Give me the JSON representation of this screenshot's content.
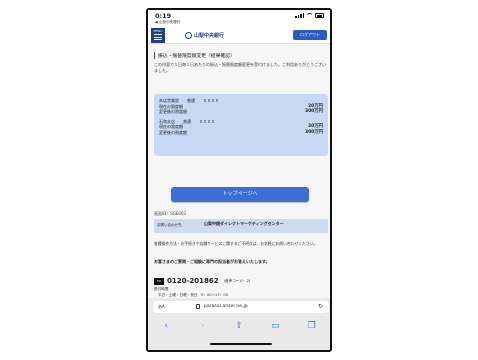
{
  "status_bar": {
    "time": "0:19",
    "back_label": "◀ 山梨中央銀行"
  },
  "header": {
    "menu_label": "MENU",
    "bank_name": "山梨中央銀行",
    "logout_label": "ログアウト"
  },
  "page": {
    "title": "振込・振替限度額変更（結果確認）",
    "intro": "この内容で１日毎１日あたりの振込・振替限度額変更を受付けました。ご利用ありがとうございました。"
  },
  "accounts": [
    {
      "branch": "本店営業部",
      "type": "普通",
      "number": "ＸＸＸＸ",
      "current_label": "現在の限度額",
      "current_amount": "20万円",
      "new_label": "変更後の限度額",
      "new_amount": "300万円"
    },
    {
      "branch": "石和支店",
      "type": "普通",
      "number": "ＸＸＸＸ",
      "current_label": "現在の限度額",
      "current_amount": "20万円",
      "new_label": "変更後の限度額",
      "new_amount": "300万円"
    }
  ],
  "top_button_label": "トップページへ",
  "screen_id": "画面ID：SGE003",
  "contact": {
    "label": "お問い合わせ先",
    "name": "山梨中銀ダイレクトマーケティングセンター",
    "description": "各種操作方法・お手続きや店舗サービスに関するご不明点は、お気軽にお問い合わせください。",
    "inquiry": "お客さまのご質問・ご相談に専門の担当者がお答えいたします。",
    "phone_icon_label": "FD",
    "phone": "0120-201862",
    "service_code": "(音声コード：2)",
    "hours_label": "受付時間",
    "hours": "平日・土曜・日曜・祝日　9：00～17：00"
  },
  "url_bar": {
    "aa_label": "あA",
    "url": "parasol.anser.ne.jp"
  },
  "toolbar": {
    "icons": [
      "chevron-left-icon",
      "chevron-right-icon",
      "share-icon",
      "bookmarks-icon",
      "tabs-icon"
    ]
  }
}
